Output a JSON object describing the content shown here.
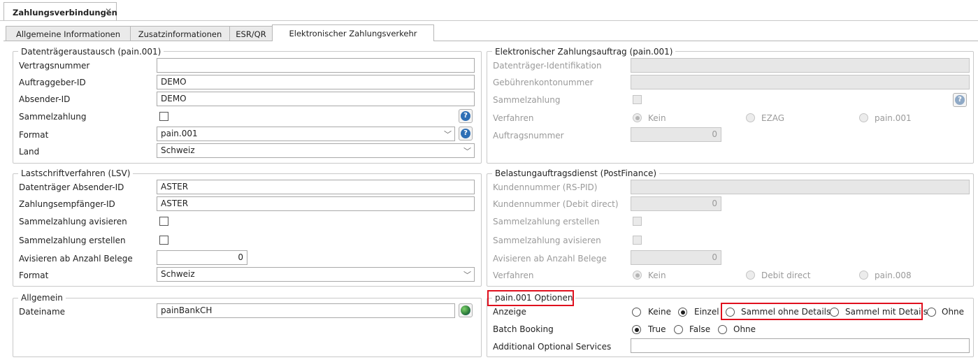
{
  "document_tab": {
    "title": "Zahlungsverbindungen",
    "close": "✕"
  },
  "tabs": [
    {
      "label": "Allgemeine Informationen"
    },
    {
      "label": "Zusatzinformationen"
    },
    {
      "label": "ESR/QR"
    },
    {
      "label": "Elektronischer Zahlungsverkehr"
    }
  ],
  "dta": {
    "title": "Datenträgeraustausch (pain.001)",
    "vertragsnummer_label": "Vertragsnummer",
    "vertragsnummer": "",
    "auftraggeber_label": "Auftraggeber-ID",
    "auftraggeber": "DEMO",
    "absender_label": "Absender-ID",
    "absender": "DEMO",
    "sammelzahlung_label": "Sammelzahlung",
    "sammelzahlung_checked": false,
    "format_label": "Format",
    "format": "pain.001",
    "land_label": "Land",
    "land": "Schweiz"
  },
  "eza": {
    "title": "Elektronischer Zahlungsauftrag (pain.001)",
    "identifikation_label": "Datenträger-Identifikation",
    "identifikation": "",
    "gebuehrenkonto_label": "Gebührenkontonummer",
    "gebuehrenkonto": "",
    "sammelzahlung_label": "Sammelzahlung",
    "verfahren_label": "Verfahren",
    "verfahren_options": [
      "Kein",
      "EZAG",
      "pain.001"
    ],
    "verfahren_selected": "Kein",
    "auftragsnummer_label": "Auftragsnummer",
    "auftragsnummer": "0"
  },
  "lsv": {
    "title": "Lastschriftverfahren (LSV)",
    "absender_label": "Datenträger Absender-ID",
    "absender": "ASTER",
    "empfaenger_label": "Zahlungsempfänger-ID",
    "empfaenger": "ASTER",
    "avisieren_label": "Sammelzahlung avisieren",
    "erstellen_label": "Sammelzahlung erstellen",
    "anzahl_label": "Avisieren ab Anzahl Belege",
    "anzahl": "0",
    "format_label": "Format",
    "format": "Schweiz"
  },
  "bad": {
    "title": "Belastungauftragsdienst (PostFinance)",
    "rs_pid_label": "Kundennummer (RS-PID)",
    "rs_pid": "",
    "debit_label": "Kundennummer (Debit direct)",
    "debit": "0",
    "erstellen_label": "Sammelzahlung erstellen",
    "avisieren_label": "Sammelzahlung avisieren",
    "anzahl_label": "Avisieren ab Anzahl Belege",
    "anzahl": "0",
    "verfahren_label": "Verfahren",
    "verfahren_options": [
      "Kein",
      "Debit direct",
      "pain.008"
    ],
    "verfahren_selected": "Kein"
  },
  "allgemein": {
    "title": "Allgemein",
    "dateiname_label": "Dateiname",
    "dateiname": "painBankCH"
  },
  "pain_options": {
    "title": "pain.001 Optionen",
    "anzeige_label": "Anzeige",
    "anzeige_options": [
      "Keine",
      "Einzel",
      "Sammel ohne Details",
      "Sammel mit Details",
      "Ohne"
    ],
    "anzeige_selected": "Einzel",
    "batch_label": "Batch Booking",
    "batch_options": [
      "True",
      "False",
      "Ohne"
    ],
    "batch_selected": "True",
    "services_label": "Additional Optional Services",
    "services": ""
  },
  "colors": {
    "highlight": "#e0101e",
    "help_icon": "#2e6fb5"
  }
}
